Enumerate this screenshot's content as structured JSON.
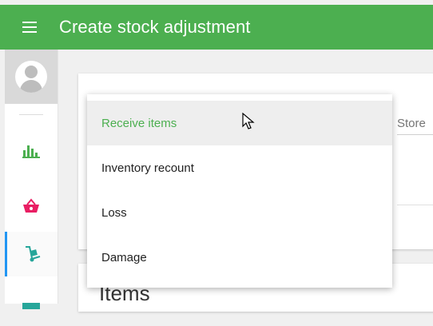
{
  "header": {
    "title": "Create stock adjustment",
    "menu_icon": "hamburger-icon"
  },
  "sidebar": {
    "items": [
      {
        "icon": "bar-chart-icon",
        "color": "#4caf50"
      },
      {
        "icon": "basket-icon",
        "color": "#e91e63"
      },
      {
        "icon": "hand-truck-icon",
        "color": "#26a69a",
        "active": true
      },
      {
        "icon": "inventory-icon",
        "color": "#26a69a"
      }
    ]
  },
  "form": {
    "store_label": "Store",
    "items_heading": "Items"
  },
  "dropdown": {
    "options": [
      "Receive items",
      "Inventory recount",
      "Loss",
      "Damage"
    ],
    "selected": "Receive items"
  },
  "colors": {
    "primary": "#4caf50",
    "accent": "#2196f3"
  }
}
